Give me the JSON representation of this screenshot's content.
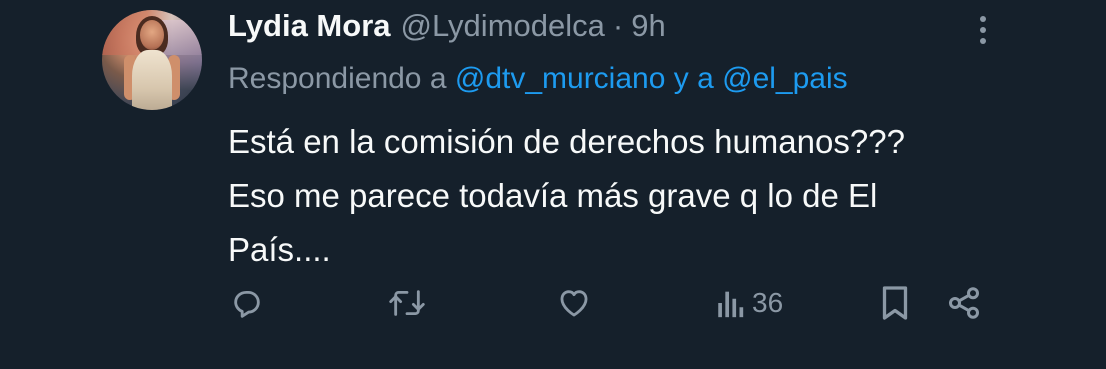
{
  "author": {
    "name": "Lydia Mora",
    "handle": "@Lydimodelca",
    "separator": "·",
    "time": "9h"
  },
  "reply": {
    "prefix": "Respondiendo a",
    "mention1": "@dtv_murciano",
    "connector": "y a",
    "mention2": "@el_pais"
  },
  "tweet": {
    "lines": [
      "Está en la comisión de derechos humanos???",
      "Eso me parece todavía más grave q lo de El",
      "País...."
    ]
  },
  "actions": {
    "reply_icon": "reply-icon",
    "retweet_icon": "retweet-icon",
    "like_icon": "heart-icon",
    "views_icon": "views-icon",
    "views_count": "36",
    "bookmark_icon": "bookmark-icon",
    "share_icon": "share-icon"
  },
  "colors": {
    "background": "#15202b",
    "text": "#f7f9f9",
    "secondary": "#8b98a5",
    "accent": "#1d9bf0"
  }
}
